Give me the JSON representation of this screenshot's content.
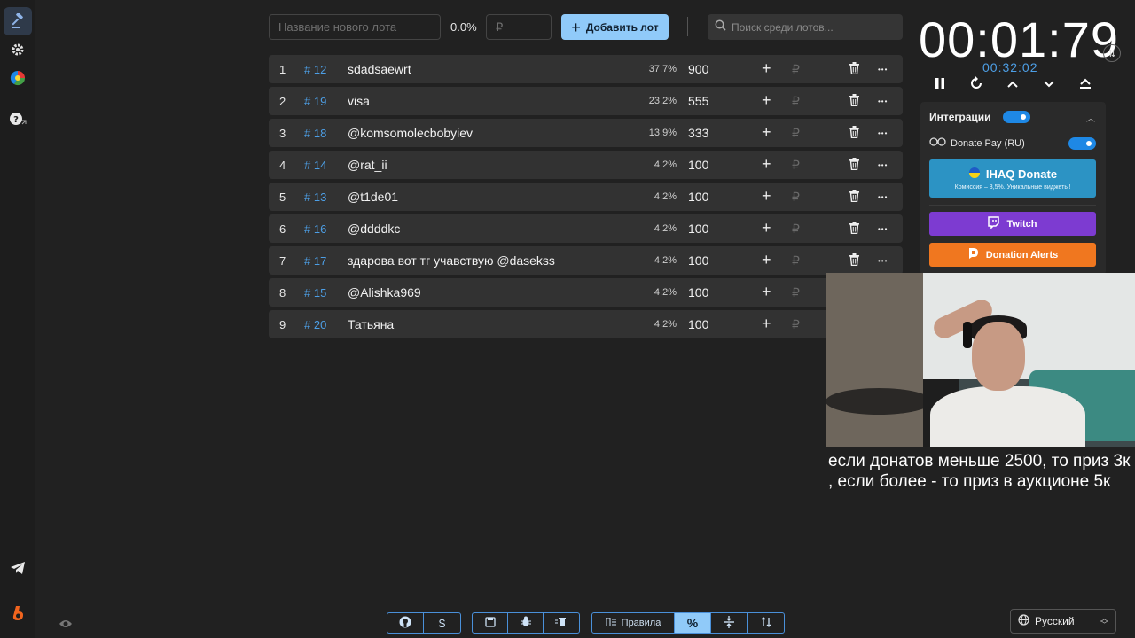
{
  "topbar": {
    "lot_name_placeholder": "Название нового лота",
    "percent": "0.0%",
    "amount_placeholder": "₽",
    "add_button": "Добавить лот",
    "search_placeholder": "Поиск среди лотов..."
  },
  "lots": [
    {
      "index": "1",
      "number": "# 12",
      "name": "sdadsaewrt",
      "percent": "37.7%",
      "amount": "900",
      "deletable": true
    },
    {
      "index": "2",
      "number": "# 19",
      "name": "visa",
      "percent": "23.2%",
      "amount": "555",
      "deletable": true
    },
    {
      "index": "3",
      "number": "# 18",
      "name": "@komsomolecbobyiev",
      "percent": "13.9%",
      "amount": "333",
      "deletable": true
    },
    {
      "index": "4",
      "number": "# 14",
      "name": "@rat_ii",
      "percent": "4.2%",
      "amount": "100",
      "deletable": true
    },
    {
      "index": "5",
      "number": "# 13",
      "name": "@t1de01",
      "percent": "4.2%",
      "amount": "100",
      "deletable": true
    },
    {
      "index": "6",
      "number": "# 16",
      "name": "@ddddkc",
      "percent": "4.2%",
      "amount": "100",
      "deletable": true
    },
    {
      "index": "7",
      "number": "# 17",
      "name": "здарова вот тг учавствую @dasekss",
      "percent": "4.2%",
      "amount": "100",
      "deletable": true
    },
    {
      "index": "8",
      "number": "# 15",
      "name": "@Alishka969",
      "percent": "4.2%",
      "amount": "100",
      "deletable": false
    },
    {
      "index": "9",
      "number": "# 20",
      "name": "Татьяна",
      "percent": "4.2%",
      "amount": "100",
      "deletable": false
    }
  ],
  "currency_symbol": "₽",
  "timer": {
    "main": "00:01:79",
    "sub": "00:32:02"
  },
  "integrations": {
    "title": "Интеграции",
    "donate_pay": "Donate Pay (RU)",
    "ihaq_title": "IHAQ Donate",
    "ihaq_subtitle": "Комиссия – 3,5%. Уникальные виджеты!",
    "twitch": "Twitch",
    "donation_alerts": "Donation Alerts"
  },
  "caption": "если донатов меньше 2500, то приз 3к , если более - то приз в аукционе 5к",
  "toolbar": {
    "rules": "Правила"
  },
  "language": "Русский",
  "colors": {
    "accent": "#90caf9",
    "link_blue": "#4d9fe6",
    "twitch": "#7d3bd1",
    "donation_alerts": "#f0771f",
    "ihaq": "#2c93c4"
  }
}
